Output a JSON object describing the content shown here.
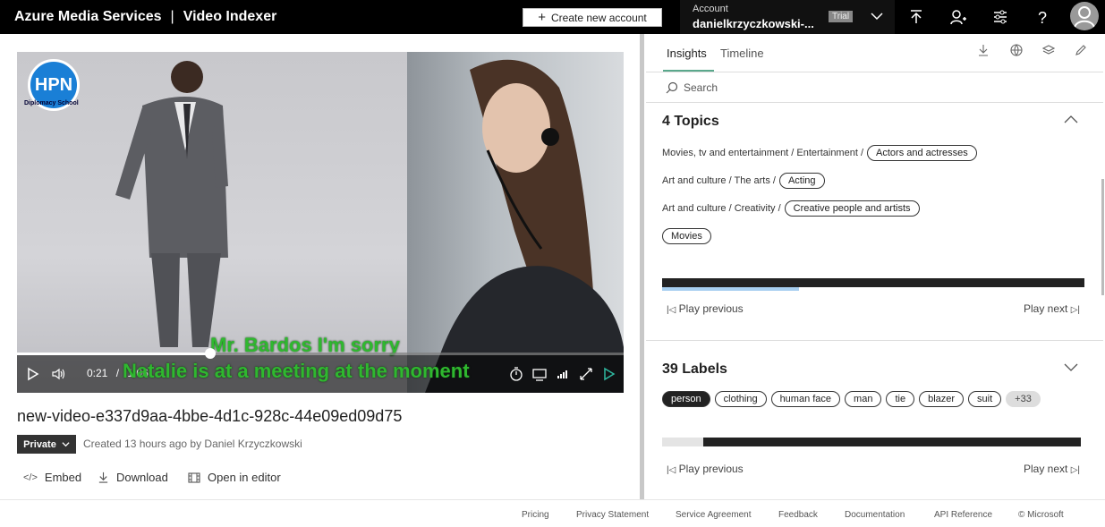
{
  "header": {
    "brand": "Azure Media Services",
    "separator": "|",
    "product": "Video Indexer",
    "create_account_label": "Create new account",
    "account_label": "Account",
    "account_name": "danielkrzyczkowski-...",
    "trial_badge": "Trial",
    "icons": [
      "upload-icon",
      "add-user-icon",
      "settings-icon",
      "help-icon",
      "avatar-icon"
    ]
  },
  "video": {
    "logo_text": "HPN",
    "logo_subtext": "Diplomacy School",
    "caption_line1": "Mr. Bardos I'm sorry",
    "caption_line2": "Natalie is at a meeting at the moment",
    "current_time": "0:21",
    "time_separator": "/",
    "duration": "1:06",
    "progress_fraction": 0.318,
    "title": "new-video-e337d9aa-4bbe-4d1c-928c-44e09ed09d75",
    "privacy_label": "Private",
    "created_text": "Created 13 hours ago by Daniel Krzyczkowski"
  },
  "actions": {
    "embed": "Embed",
    "download": "Download",
    "open_editor": "Open in editor"
  },
  "insights": {
    "tabs": [
      "Insights",
      "Timeline"
    ],
    "active_tab": "Insights",
    "search_placeholder": "Search",
    "topics": {
      "title": "4 Topics",
      "rows": [
        {
          "path": "Movies, tv and entertainment / Entertainment /",
          "tag": "Actors and actresses"
        },
        {
          "path": "Art and culture / The arts /",
          "tag": "Acting"
        },
        {
          "path": "Art and culture / Creativity /",
          "tag": "Creative people and artists"
        },
        {
          "path": "",
          "tag": "Movies"
        }
      ],
      "play_previous": "Play previous",
      "play_next": "Play next"
    },
    "labels": {
      "title": "39 Labels",
      "items": [
        "person",
        "clothing",
        "human face",
        "man",
        "tie",
        "blazer",
        "suit"
      ],
      "selected": "person",
      "more": "+33",
      "play_previous": "Play previous",
      "play_next": "Play next"
    }
  },
  "footer": {
    "links": [
      "Pricing",
      "Privacy Statement",
      "Service Agreement",
      "Feedback",
      "Documentation",
      "API Reference",
      "© Microsoft"
    ]
  },
  "colors": {
    "accent": "#5aa88c",
    "caption": "#2fb82f",
    "topbar": "#000000",
    "timeline_highlight": "#a7cff0"
  }
}
